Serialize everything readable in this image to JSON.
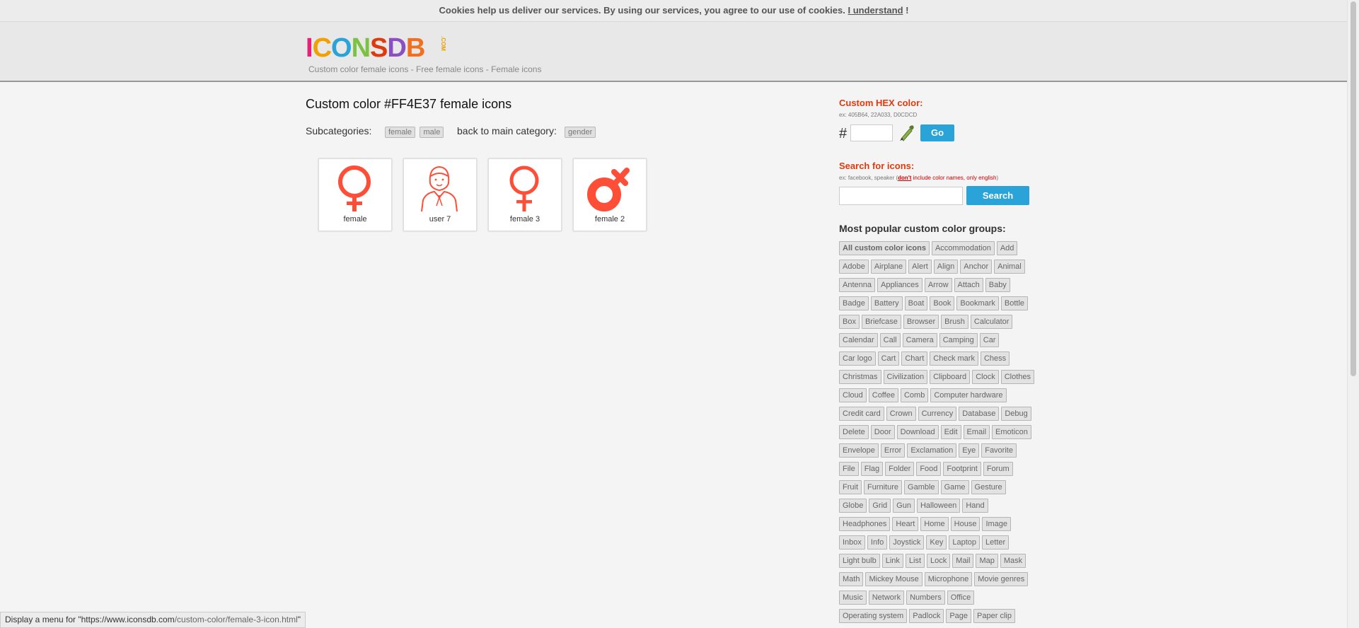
{
  "cookie": {
    "text": "Cookies help us deliver our services. By using our services, you agree to our use of cookies.",
    "link": "I understand",
    "suffix": "!"
  },
  "header": {
    "logo": "ICONSDB",
    "logo_com": ".COM",
    "tagline": "Custom color female icons - Free female icons - Female icons"
  },
  "main": {
    "title": "Custom color #FF4E37 female icons",
    "subcategories_label": "Subcategories:",
    "subcategories": [
      "female",
      "male"
    ],
    "back_label": "back to main category:",
    "back_tag": "gender",
    "icon_color": "#FF4E37",
    "icons": [
      {
        "label": "female",
        "icon": "female-symbol-icon"
      },
      {
        "label": "user 7",
        "icon": "user-female-icon"
      },
      {
        "label": "female 3",
        "icon": "female-symbol-icon"
      },
      {
        "label": "female 2",
        "icon": "female-bold-symbol-icon"
      }
    ]
  },
  "sidebar": {
    "hex_title": "Custom HEX color:",
    "hex_example": "ex: 405B64, 22A033, D0CDCD",
    "hash": "#",
    "hex_value": "",
    "go": "Go",
    "search_title": "Search for icons:",
    "search_example_pre": "ex: facebook, speaker (",
    "search_example_dont": "don't",
    "search_example_post": " include color names, only english",
    "search_example_close": ")",
    "search_value": "",
    "search_button": "Search",
    "popular_title": "Most popular custom color groups:",
    "groups": [
      [
        "All custom color icons",
        "Accommodation",
        "Add"
      ],
      [
        "Adobe",
        "Airplane",
        "Alert",
        "Align",
        "Anchor",
        "Animal"
      ],
      [
        "Antenna",
        "Appliances",
        "Arrow",
        "Attach",
        "Baby"
      ],
      [
        "Badge",
        "Battery",
        "Boat",
        "Book",
        "Bookmark",
        "Bottle"
      ],
      [
        "Box",
        "Briefcase",
        "Browser",
        "Brush",
        "Calculator"
      ],
      [
        "Calendar",
        "Call",
        "Camera",
        "Camping",
        "Car"
      ],
      [
        "Car logo",
        "Cart",
        "Chart",
        "Check mark",
        "Chess"
      ],
      [
        "Christmas",
        "Civilization",
        "Clipboard",
        "Clock",
        "Clothes"
      ],
      [
        "Cloud",
        "Coffee",
        "Comb",
        "Computer hardware"
      ],
      [
        "Credit card",
        "Crown",
        "Currency",
        "Database",
        "Debug"
      ],
      [
        "Delete",
        "Door",
        "Download",
        "Edit",
        "Email",
        "Emoticon"
      ],
      [
        "Envelope",
        "Error",
        "Exclamation",
        "Eye",
        "Favorite"
      ],
      [
        "File",
        "Flag",
        "Folder",
        "Food",
        "Footprint",
        "Forum"
      ],
      [
        "Fruit",
        "Furniture",
        "Gamble",
        "Game",
        "Gesture"
      ],
      [
        "Globe",
        "Grid",
        "Gun",
        "Halloween",
        "Hand"
      ],
      [
        "Headphones",
        "Heart",
        "Home",
        "House",
        "Image"
      ],
      [
        "Inbox",
        "Info",
        "Joystick",
        "Key",
        "Laptop",
        "Letter"
      ],
      [
        "Light bulb",
        "Link",
        "List",
        "Lock",
        "Mail",
        "Map",
        "Mask"
      ],
      [
        "Math",
        "Mickey Mouse",
        "Microphone",
        "Movie genres"
      ],
      [
        "Music",
        "Network",
        "Numbers",
        "Office"
      ],
      [
        "Operating system",
        "Padlock",
        "Page",
        "Paper clip"
      ]
    ]
  },
  "status_bar": {
    "prefix": "Display a menu for \"https://www.iconsdb.com",
    "path": "/custom-color/female-3-icon.html",
    "suffix": "\""
  },
  "colors": {
    "accent_red": "#E03A0C",
    "button_blue": "#2AA3D8",
    "icon": "#FF4E37"
  }
}
